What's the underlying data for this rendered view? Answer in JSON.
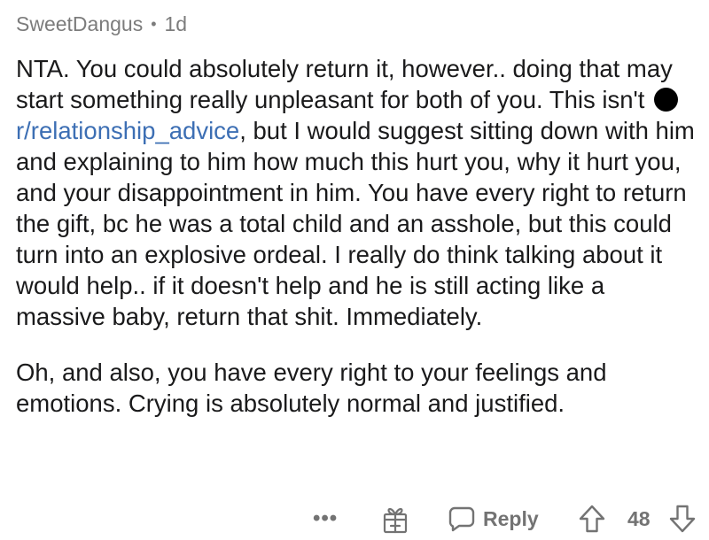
{
  "comment": {
    "author": "SweetDangus",
    "separator": "•",
    "age": "1d",
    "paragraph1": {
      "before_link": "NTA. You could absolutely return it, however.. doing that may start something really unpleasant for both of you. This isn't",
      "subreddit_link": "r/relationship_advice",
      "after_link": ", but I would suggest sitting down with him and explaining to him how much this hurt you, why it hurt you, and your disappointment in him. You have every right to return the gift, bc he was a total child and an asshole, but this could turn into an explosive ordeal. I really do think talking about it would help.. if it doesn't help and he is still acting like a massive baby, return that shit. Immediately."
    },
    "paragraph2": "Oh, and also, you have every right to your feelings and emotions. Crying is absolutely normal and justified."
  },
  "actions": {
    "more": "•••",
    "more_icon": "ellipsis-icon",
    "gift_icon": "gift-award-icon",
    "reply_label": "Reply",
    "reply_icon": "speech-bubble-icon",
    "upvote_icon": "arrow-up-icon",
    "score": "48",
    "downvote_icon": "arrow-down-icon"
  },
  "colors": {
    "text": "#1a1a1b",
    "meta": "#7c7c7c",
    "link": "#3d6fb4",
    "action": "#737373"
  }
}
